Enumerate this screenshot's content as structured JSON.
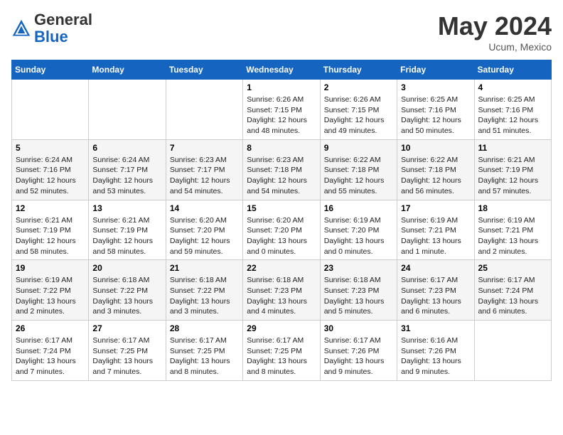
{
  "header": {
    "logo_general": "General",
    "logo_blue": "Blue",
    "month": "May 2024",
    "location": "Ucum, Mexico"
  },
  "weekdays": [
    "Sunday",
    "Monday",
    "Tuesday",
    "Wednesday",
    "Thursday",
    "Friday",
    "Saturday"
  ],
  "weeks": [
    [
      null,
      null,
      null,
      {
        "day": "1",
        "sunrise": "Sunrise: 6:26 AM",
        "sunset": "Sunset: 7:15 PM",
        "daylight": "Daylight: 12 hours and 48 minutes."
      },
      {
        "day": "2",
        "sunrise": "Sunrise: 6:26 AM",
        "sunset": "Sunset: 7:15 PM",
        "daylight": "Daylight: 12 hours and 49 minutes."
      },
      {
        "day": "3",
        "sunrise": "Sunrise: 6:25 AM",
        "sunset": "Sunset: 7:16 PM",
        "daylight": "Daylight: 12 hours and 50 minutes."
      },
      {
        "day": "4",
        "sunrise": "Sunrise: 6:25 AM",
        "sunset": "Sunset: 7:16 PM",
        "daylight": "Daylight: 12 hours and 51 minutes."
      }
    ],
    [
      {
        "day": "5",
        "sunrise": "Sunrise: 6:24 AM",
        "sunset": "Sunset: 7:16 PM",
        "daylight": "Daylight: 12 hours and 52 minutes."
      },
      {
        "day": "6",
        "sunrise": "Sunrise: 6:24 AM",
        "sunset": "Sunset: 7:17 PM",
        "daylight": "Daylight: 12 hours and 53 minutes."
      },
      {
        "day": "7",
        "sunrise": "Sunrise: 6:23 AM",
        "sunset": "Sunset: 7:17 PM",
        "daylight": "Daylight: 12 hours and 54 minutes."
      },
      {
        "day": "8",
        "sunrise": "Sunrise: 6:23 AM",
        "sunset": "Sunset: 7:18 PM",
        "daylight": "Daylight: 12 hours and 54 minutes."
      },
      {
        "day": "9",
        "sunrise": "Sunrise: 6:22 AM",
        "sunset": "Sunset: 7:18 PM",
        "daylight": "Daylight: 12 hours and 55 minutes."
      },
      {
        "day": "10",
        "sunrise": "Sunrise: 6:22 AM",
        "sunset": "Sunset: 7:18 PM",
        "daylight": "Daylight: 12 hours and 56 minutes."
      },
      {
        "day": "11",
        "sunrise": "Sunrise: 6:21 AM",
        "sunset": "Sunset: 7:19 PM",
        "daylight": "Daylight: 12 hours and 57 minutes."
      }
    ],
    [
      {
        "day": "12",
        "sunrise": "Sunrise: 6:21 AM",
        "sunset": "Sunset: 7:19 PM",
        "daylight": "Daylight: 12 hours and 58 minutes."
      },
      {
        "day": "13",
        "sunrise": "Sunrise: 6:21 AM",
        "sunset": "Sunset: 7:19 PM",
        "daylight": "Daylight: 12 hours and 58 minutes."
      },
      {
        "day": "14",
        "sunrise": "Sunrise: 6:20 AM",
        "sunset": "Sunset: 7:20 PM",
        "daylight": "Daylight: 12 hours and 59 minutes."
      },
      {
        "day": "15",
        "sunrise": "Sunrise: 6:20 AM",
        "sunset": "Sunset: 7:20 PM",
        "daylight": "Daylight: 13 hours and 0 minutes."
      },
      {
        "day": "16",
        "sunrise": "Sunrise: 6:19 AM",
        "sunset": "Sunset: 7:20 PM",
        "daylight": "Daylight: 13 hours and 0 minutes."
      },
      {
        "day": "17",
        "sunrise": "Sunrise: 6:19 AM",
        "sunset": "Sunset: 7:21 PM",
        "daylight": "Daylight: 13 hours and 1 minute."
      },
      {
        "day": "18",
        "sunrise": "Sunrise: 6:19 AM",
        "sunset": "Sunset: 7:21 PM",
        "daylight": "Daylight: 13 hours and 2 minutes."
      }
    ],
    [
      {
        "day": "19",
        "sunrise": "Sunrise: 6:19 AM",
        "sunset": "Sunset: 7:22 PM",
        "daylight": "Daylight: 13 hours and 2 minutes."
      },
      {
        "day": "20",
        "sunrise": "Sunrise: 6:18 AM",
        "sunset": "Sunset: 7:22 PM",
        "daylight": "Daylight: 13 hours and 3 minutes."
      },
      {
        "day": "21",
        "sunrise": "Sunrise: 6:18 AM",
        "sunset": "Sunset: 7:22 PM",
        "daylight": "Daylight: 13 hours and 3 minutes."
      },
      {
        "day": "22",
        "sunrise": "Sunrise: 6:18 AM",
        "sunset": "Sunset: 7:23 PM",
        "daylight": "Daylight: 13 hours and 4 minutes."
      },
      {
        "day": "23",
        "sunrise": "Sunrise: 6:18 AM",
        "sunset": "Sunset: 7:23 PM",
        "daylight": "Daylight: 13 hours and 5 minutes."
      },
      {
        "day": "24",
        "sunrise": "Sunrise: 6:17 AM",
        "sunset": "Sunset: 7:23 PM",
        "daylight": "Daylight: 13 hours and 6 minutes."
      },
      {
        "day": "25",
        "sunrise": "Sunrise: 6:17 AM",
        "sunset": "Sunset: 7:24 PM",
        "daylight": "Daylight: 13 hours and 6 minutes."
      }
    ],
    [
      {
        "day": "26",
        "sunrise": "Sunrise: 6:17 AM",
        "sunset": "Sunset: 7:24 PM",
        "daylight": "Daylight: 13 hours and 7 minutes."
      },
      {
        "day": "27",
        "sunrise": "Sunrise: 6:17 AM",
        "sunset": "Sunset: 7:25 PM",
        "daylight": "Daylight: 13 hours and 7 minutes."
      },
      {
        "day": "28",
        "sunrise": "Sunrise: 6:17 AM",
        "sunset": "Sunset: 7:25 PM",
        "daylight": "Daylight: 13 hours and 8 minutes."
      },
      {
        "day": "29",
        "sunrise": "Sunrise: 6:17 AM",
        "sunset": "Sunset: 7:25 PM",
        "daylight": "Daylight: 13 hours and 8 minutes."
      },
      {
        "day": "30",
        "sunrise": "Sunrise: 6:17 AM",
        "sunset": "Sunset: 7:26 PM",
        "daylight": "Daylight: 13 hours and 9 minutes."
      },
      {
        "day": "31",
        "sunrise": "Sunrise: 6:16 AM",
        "sunset": "Sunset: 7:26 PM",
        "daylight": "Daylight: 13 hours and 9 minutes."
      },
      null
    ]
  ]
}
